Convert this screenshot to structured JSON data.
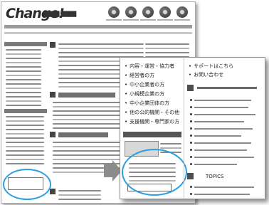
{
  "logo_text": "Change!",
  "site_title": "████ ████",
  "zoom_panel": {
    "menu_items": [
      "内容・運営・協力者",
      "経営者の方",
      "中小企業者の方",
      "小規模企業の方",
      "中小企業団体の方",
      "他の公的機関・その他",
      "支援機関・専門家の方"
    ],
    "right_items": [
      "サポートはこちら",
      "お問い合わせ"
    ],
    "topics_label": "TOPICS"
  }
}
